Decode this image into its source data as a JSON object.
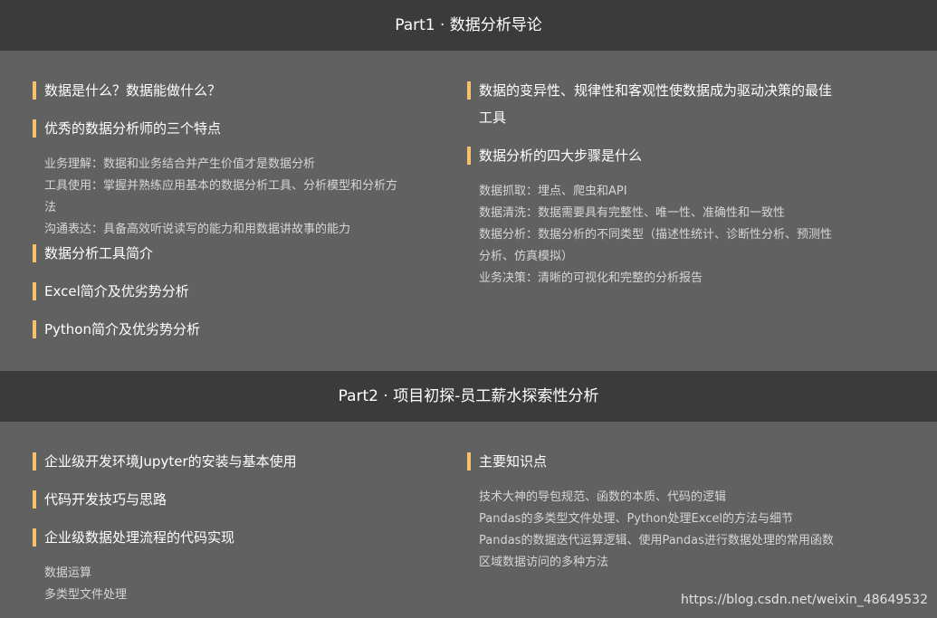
{
  "part1": {
    "title": "Part1 · 数据分析导论",
    "left": {
      "h1": "数据是什么？数据能做什么？",
      "h2": "优秀的数据分析师的三个特点",
      "h2_items": [
        "业务理解：数据和业务结合并产生价值才是数据分析",
        "工具使用：掌握并熟练应用基本的数据分析工具、分析模型和分析方",
        "法",
        "沟通表达：具备高效听说读写的能力和用数据讲故事的能力"
      ],
      "h3": "数据分析工具简介",
      "h4": "Excel简介及优劣势分析",
      "h5": "Python简介及优劣势分析"
    },
    "right": {
      "h1_line1": "数据的变异性、规律性和客观性使数据成为驱动决策的最佳",
      "h1_line2": "工具",
      "h2": "数据分析的四大步骤是什么",
      "h2_items": [
        "数据抓取：埋点、爬虫和API",
        "数据清洗：数据需要具有完整性、唯一性、准确性和一致性",
        "数据分析：数据分析的不同类型（描述性统计、诊断性分析、预测性",
        "分析、仿真模拟）",
        "业务决策：清晰的可视化和完整的分析报告"
      ]
    }
  },
  "part2": {
    "title": "Part2 · 项目初探-员工薪水探索性分析",
    "left": {
      "h1": "企业级开发环境Jupyter的安装与基本使用",
      "h2": "代码开发技巧与思路",
      "h3": "企业级数据处理流程的代码实现",
      "h3_items": [
        "数据运算",
        "多类型文件处理"
      ]
    },
    "right": {
      "h1": "主要知识点",
      "h1_items": [
        "技术大神的导包规范、函数的本质、代码的逻辑",
        "Pandas的多类型文件处理、Python处理Excel的方法与细节",
        "Pandas的数据迭代运算逻辑、使用Pandas进行数据处理的常用函数",
        "区域数据访问的多种方法"
      ]
    }
  },
  "watermark": "https://blog.csdn.net/weixin_48649532",
  "colors": {
    "header_bg": "#3b3b3b",
    "panel_bg": "#616161",
    "accent_bar": "#f5c26b",
    "sub_text": "#d6d6d6"
  }
}
